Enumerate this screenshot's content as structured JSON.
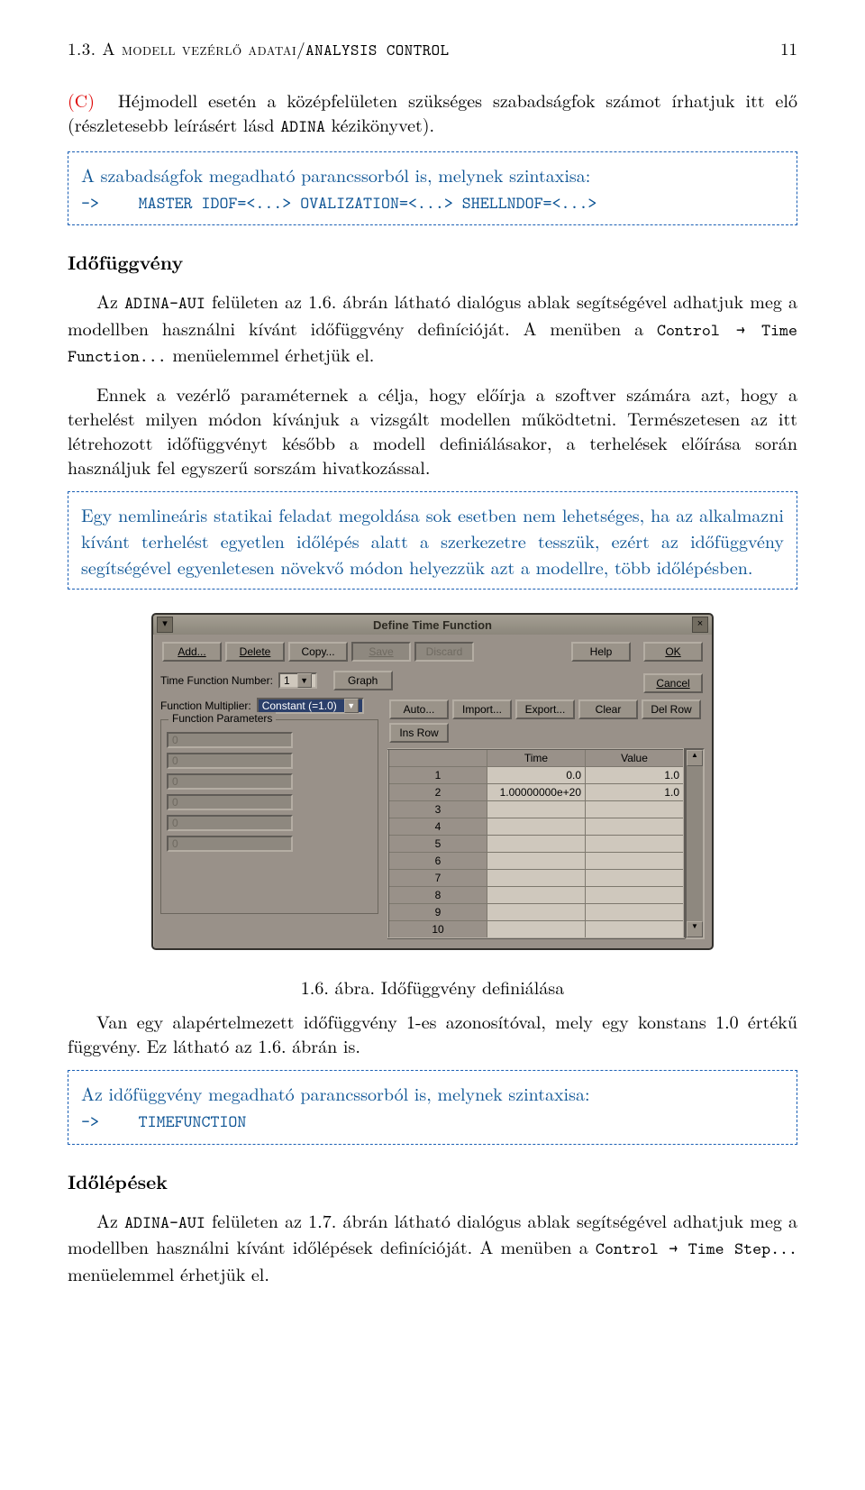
{
  "header": {
    "left_before_tt": "1.3.  A modell vezérlő adatai/",
    "tt": "ANALYSIS CONTROL",
    "page": "11"
  },
  "paraC": {
    "label": "(C)",
    "text_before": " Héjmodell esetén a középfelületen szükséges szabadságfok számot írhatjuk itt elő (részletesebb leírásért lásd ",
    "tt1": "ADINA",
    "text_after": " kézikönyvet)."
  },
  "box1": {
    "line1": "A szabadságfok megadható parancssorból is, melynek szintaxisa:",
    "prompt": "->",
    "code": "MASTER IDOF=<...> OVALIZATION=<...> SHELLNDOF=<...>"
  },
  "heading1": "Időfüggvény",
  "p1": {
    "a": "Az ",
    "tt": "ADINA-AUI",
    "b": " felületen az 1.6. ábrán látható dialógus ablak segítségével adhatjuk meg a modellben használni kívánt időfüggvény definícióját. A menüben a ",
    "tt2": "Control → Time Function...",
    "c": " menüelemmel érhetjük el."
  },
  "p2": "Ennek a vezérlő paraméternek a célja, hogy előírja a szoftver számára azt, hogy a terhelést milyen módon kívánjuk a vizsgált modellen működtetni. Természetesen az itt létrehozott időfüggvényt később a modell definiálásakor, a terhelések előírása során használjuk fel egyszerű sorszám hivatkozással.",
  "box2": "Egy nemlineáris statikai feladat megoldása sok esetben nem lehetséges, ha az alkalmazni kívánt terhelést egyetlen időlépés alatt a szerkezetre tesszük, ezért az időfüggvény segítségével egyenletesen növekvő módon helyezzük azt a modellre, több időlépésben.",
  "dialog": {
    "title": "Define Time Function",
    "toolbar": {
      "add": "Add...",
      "delete": "Delete",
      "copy": "Copy...",
      "save": "Save",
      "discard": "Discard",
      "help": "Help",
      "ok": "OK",
      "cancel": "Cancel"
    },
    "tfn_label": "Time Function Number:",
    "tfn_value": "1",
    "graph": "Graph",
    "fm_label": "Function Multiplier:",
    "fm_value": "Constant (=1.0)",
    "btns2": {
      "auto": "Auto...",
      "import": "Import...",
      "export": "Export...",
      "clear": "Clear",
      "delrow": "Del Row",
      "insrow": "Ins Row"
    },
    "group_legend": "Function Parameters",
    "param_default": "0",
    "table": {
      "h1": "Time",
      "h2": "Value",
      "r1": {
        "t": "0.0",
        "v": "1.0"
      },
      "r2": {
        "t": "1.00000000e+20",
        "v": "1.0"
      }
    }
  },
  "caption": "1.6. ábra. Időfüggvény definiálása",
  "p3": "Van egy alapértelmezett időfüggvény 1-es azonosítóval, mely egy konstans 1.0 értékű függvény. Ez látható az 1.6. ábrán is.",
  "box3": {
    "line1": "Az időfüggvény megadható parancssorból is, melynek szintaxisa:",
    "prompt": "->",
    "code": "TIMEFUNCTION"
  },
  "heading2": "Időlépések",
  "p4": {
    "a": "Az ",
    "tt": "ADINA-AUI",
    "b": " felületen az 1.7. ábrán látható dialógus ablak segítségével adhatjuk meg a modellben használni kívánt időlépések definícióját.  A menüben a ",
    "tt2": "Control → Time Step...",
    "c": " menüelemmel érhetjük el."
  }
}
